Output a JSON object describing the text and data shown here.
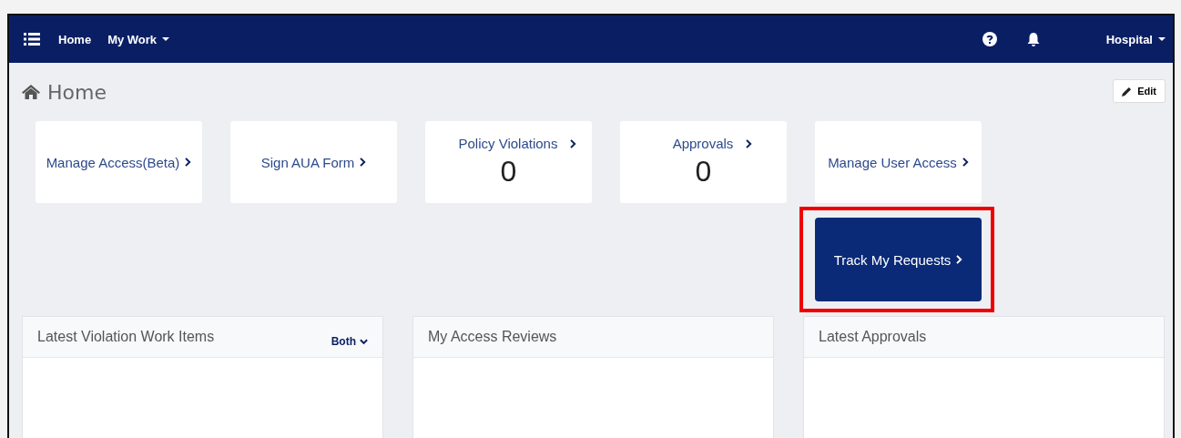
{
  "navbar": {
    "items": [
      {
        "label": "Home",
        "dropdown": false
      },
      {
        "label": "My Work",
        "dropdown": true
      }
    ],
    "user_menu": {
      "label": "Hospital"
    }
  },
  "page": {
    "title": "Home",
    "edit_button": "Edit"
  },
  "tiles": [
    {
      "kind": "link",
      "label": "Manage Access(Beta)",
      "highlighted": false
    },
    {
      "kind": "link",
      "label": "Sign AUA Form",
      "highlighted": false
    },
    {
      "kind": "count",
      "label": "Policy Violations",
      "count": "0",
      "highlighted": false
    },
    {
      "kind": "count",
      "label": "Approvals",
      "count": "0",
      "highlighted": false
    },
    {
      "kind": "link",
      "label": "Manage User Access",
      "highlighted": false
    },
    {
      "kind": "primary",
      "label": "Track My Requests",
      "highlighted": true
    }
  ],
  "panels": [
    {
      "title": "Latest Violation Work Items",
      "filter": "Both"
    },
    {
      "title": "My Access Reviews"
    },
    {
      "title": "Latest Approvals"
    }
  ]
}
